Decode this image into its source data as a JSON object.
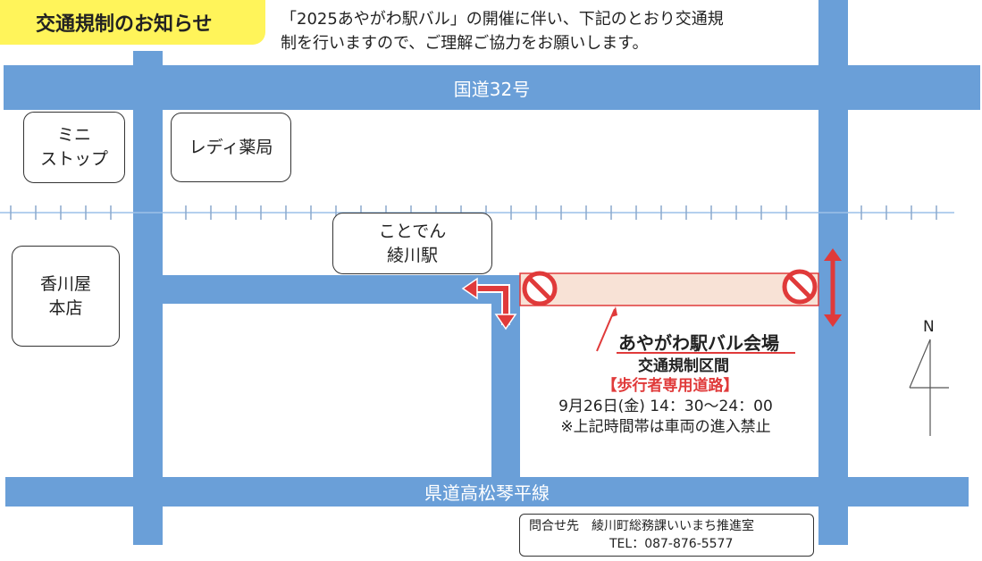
{
  "header": {
    "title": "交通規制のお知らせ",
    "notice_line1": "「2025あやがわ駅バル」の開催に伴い、下記のとおり交通規",
    "notice_line2": "制を行いますので、ご理解ご協力をお願いします。"
  },
  "roads": {
    "national": "国道32号",
    "prefectural": "県道高松琴平線"
  },
  "places": {
    "ministop": [
      "ミニ",
      "ストップ"
    ],
    "pharmacy": "レディ薬局",
    "station": [
      "ことでん",
      "綾川駅"
    ],
    "kagawaya": [
      "香川屋",
      "本店"
    ]
  },
  "venue": {
    "name": "あやがわ駅バル会場",
    "section": "交通規制区間",
    "pedestrian": "【歩行者専用道路】",
    "time": "9月26日(金) 14：30〜24：00",
    "note": "※上記時間帯は車両の進入禁止"
  },
  "compass": {
    "label": "N"
  },
  "contact": {
    "line1": "問合せ先　綾川町総務課いいまち推進室",
    "line2": "TEL：087-876-5577"
  },
  "colors": {
    "road": "#6a9fd8",
    "railway": "#9cc0e8",
    "restricted_fill": "#f8e2d6",
    "restricted_border": "#e03a3a",
    "no_entry": "#e03a3a",
    "title_bg": "#fff45a"
  }
}
